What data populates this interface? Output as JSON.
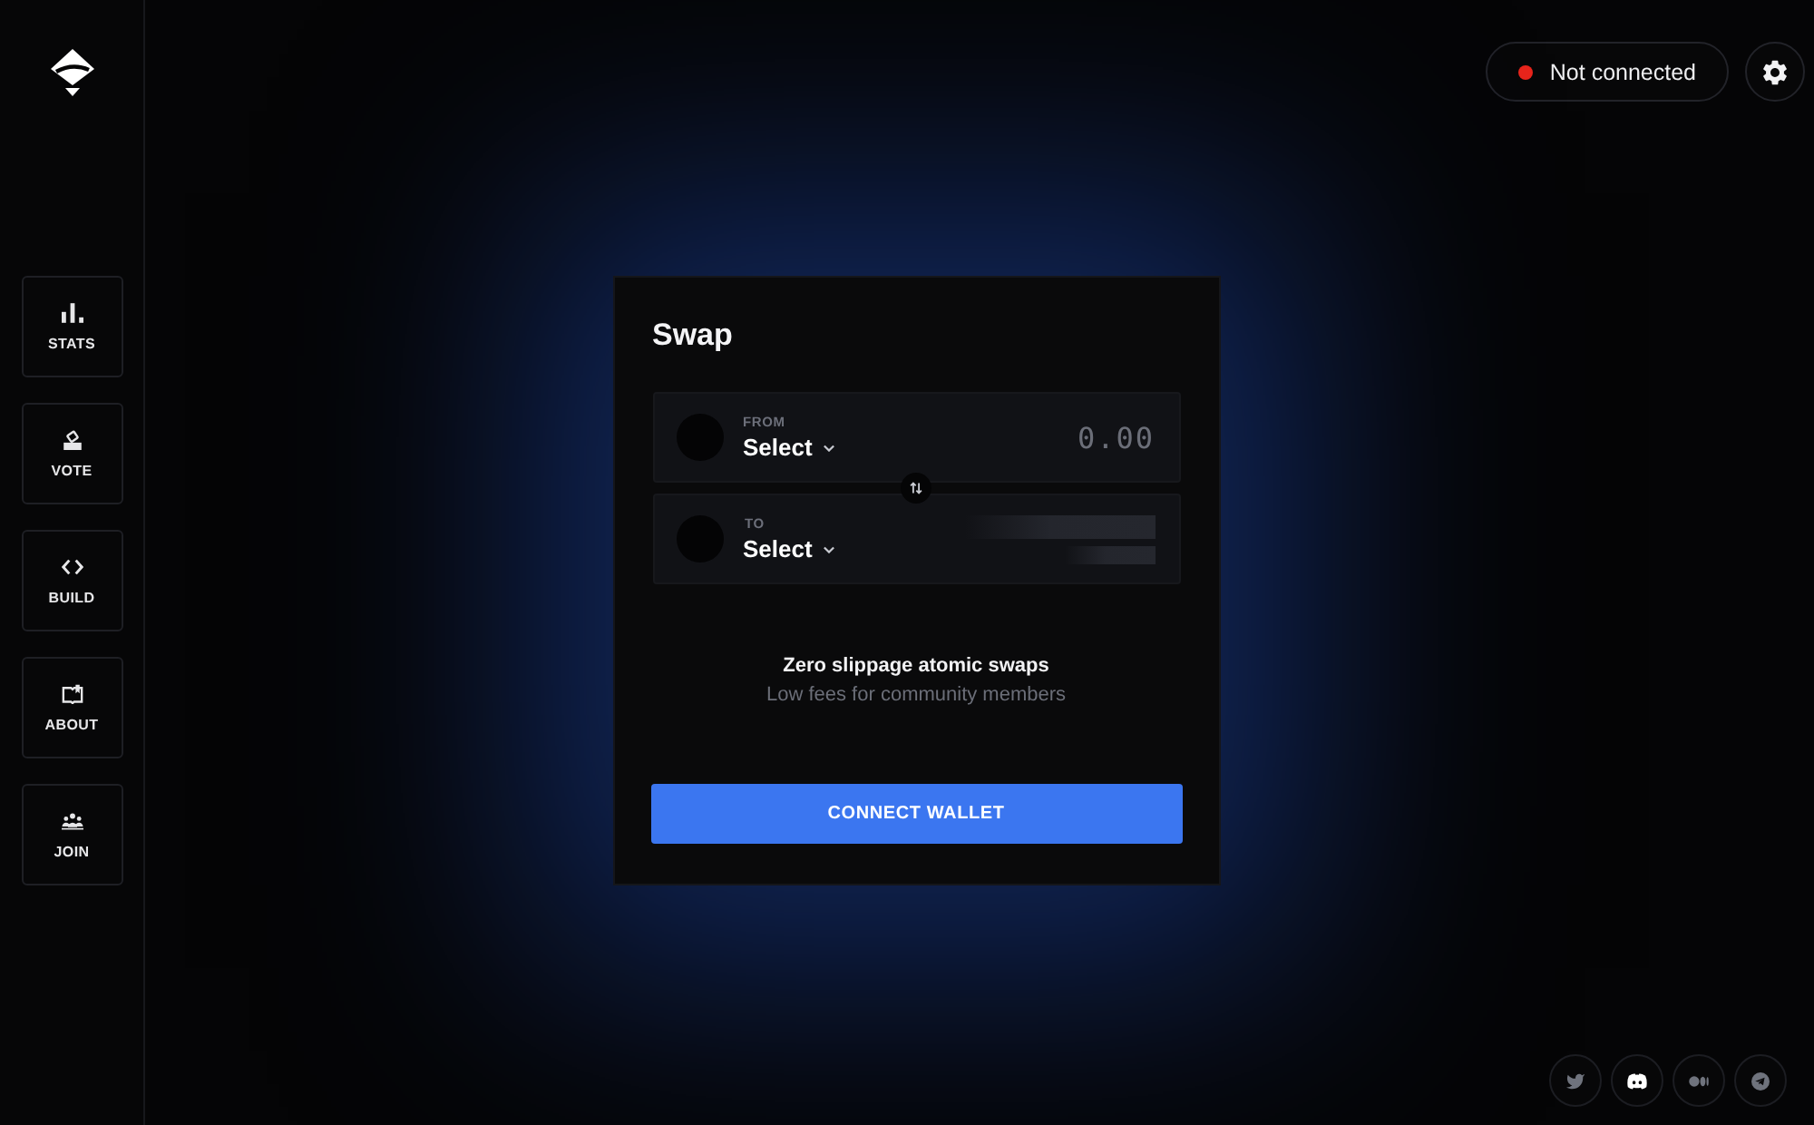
{
  "sidebar": {
    "nav": [
      {
        "label": "STATS"
      },
      {
        "label": "VOTE"
      },
      {
        "label": "BUILD"
      },
      {
        "label": "ABOUT"
      },
      {
        "label": "JOIN"
      }
    ]
  },
  "header": {
    "status": {
      "label": "Not connected",
      "connected": false
    }
  },
  "swap": {
    "title": "Swap",
    "from": {
      "label": "FROM",
      "token": "Select",
      "amount": {
        "placeholder": "0.00"
      }
    },
    "to": {
      "label": "TO",
      "token": "Select",
      "loading": true
    },
    "tagline": "Zero slippage atomic swaps",
    "subline": "Low fees for community members",
    "button": "CONNECT WALLET"
  },
  "social_links": [
    {
      "highlighted": false
    },
    {
      "highlighted": true
    },
    {
      "highlighted": false
    },
    {
      "highlighted": false
    }
  ]
}
